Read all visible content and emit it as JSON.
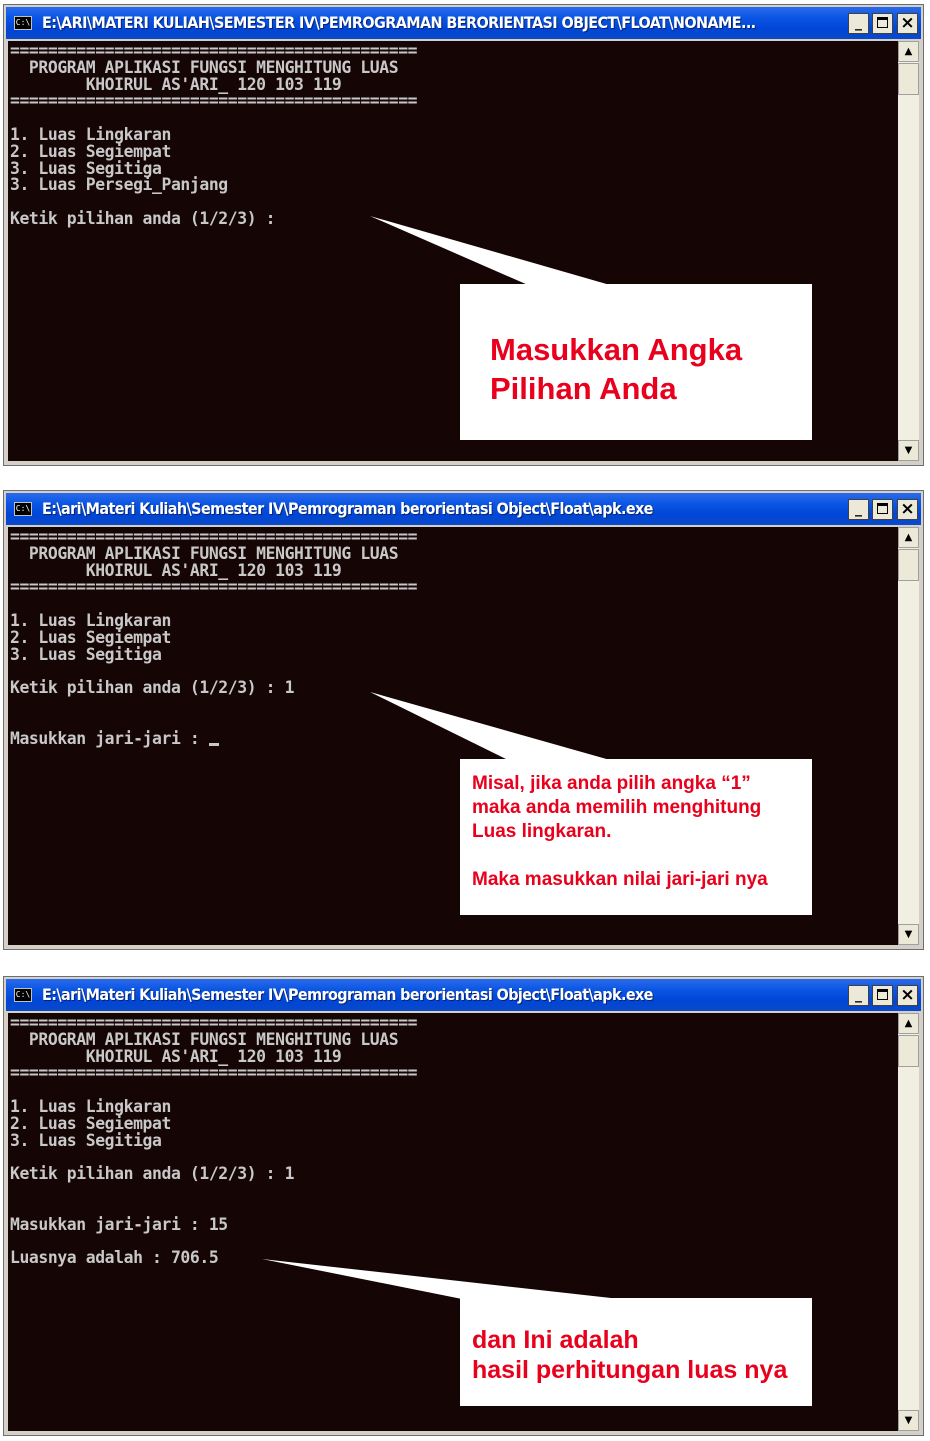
{
  "windows": [
    {
      "title": "E:\\ARI\\MATERI KULIAH\\SEMESTER IV\\PEMROGRAMAN BERORIENTASI OBJECT\\FLOAT\\NONAME...",
      "console_lines": [
        "===========================================",
        "  PROGRAM APLIKASI FUNGSI MENGHITUNG LUAS",
        "        KHOIRUL AS'ARI_ 120 103 119",
        "===========================================",
        "",
        "1. Luas Lingkaran",
        "2. Luas Segiempat",
        "3. Luas Segitiga",
        "3. Luas Persegi_Panjang",
        "",
        "Ketik pilihan anda (1/2/3) :"
      ],
      "callout_lines": [
        "Masukkan Angka",
        "Pilihan Anda"
      ]
    },
    {
      "title": "E:\\ari\\Materi Kuliah\\Semester IV\\Pemrograman berorientasi Object\\Float\\apk.exe",
      "console_lines": [
        "===========================================",
        "  PROGRAM APLIKASI FUNGSI MENGHITUNG LUAS",
        "        KHOIRUL AS'ARI_ 120 103 119",
        "===========================================",
        "",
        "1. Luas Lingkaran",
        "2. Luas Segiempat",
        "3. Luas Segitiga",
        "",
        "Ketik pilihan anda (1/2/3) : 1",
        "",
        "",
        "Masukkan jari-jari : "
      ],
      "callout_lines": [
        "Misal, jika anda pilih angka “1”",
        "maka anda memilih menghitung",
        "Luas lingkaran.",
        "",
        "Maka masukkan nilai jari-jari nya"
      ]
    },
    {
      "title": "E:\\ari\\Materi Kuliah\\Semester IV\\Pemrograman berorientasi Object\\Float\\apk.exe",
      "console_lines": [
        "===========================================",
        "  PROGRAM APLIKASI FUNGSI MENGHITUNG LUAS",
        "        KHOIRUL AS'ARI_ 120 103 119",
        "===========================================",
        "",
        "1. Luas Lingkaran",
        "2. Luas Segiempat",
        "3. Luas Segitiga",
        "",
        "Ketik pilihan anda (1/2/3) : 1",
        "",
        "",
        "Masukkan jari-jari : 15",
        "",
        "Luasnya adalah : 706.5"
      ],
      "callout_lines": [
        "dan Ini adalah",
        "hasil perhitungan luas nya"
      ]
    }
  ],
  "window_controls": {
    "minimize": "_",
    "maximize": "",
    "close": "×"
  },
  "scroll_arrows": {
    "up": "▲",
    "down": "▼"
  },
  "icon_glyph": "C:\\",
  "colors": {
    "titlebar": "#0a55e4",
    "console_bg": "#150505",
    "console_text": "#c8c8c8",
    "callout_text": "#e8001c",
    "callout_bg": "#ffffff"
  }
}
